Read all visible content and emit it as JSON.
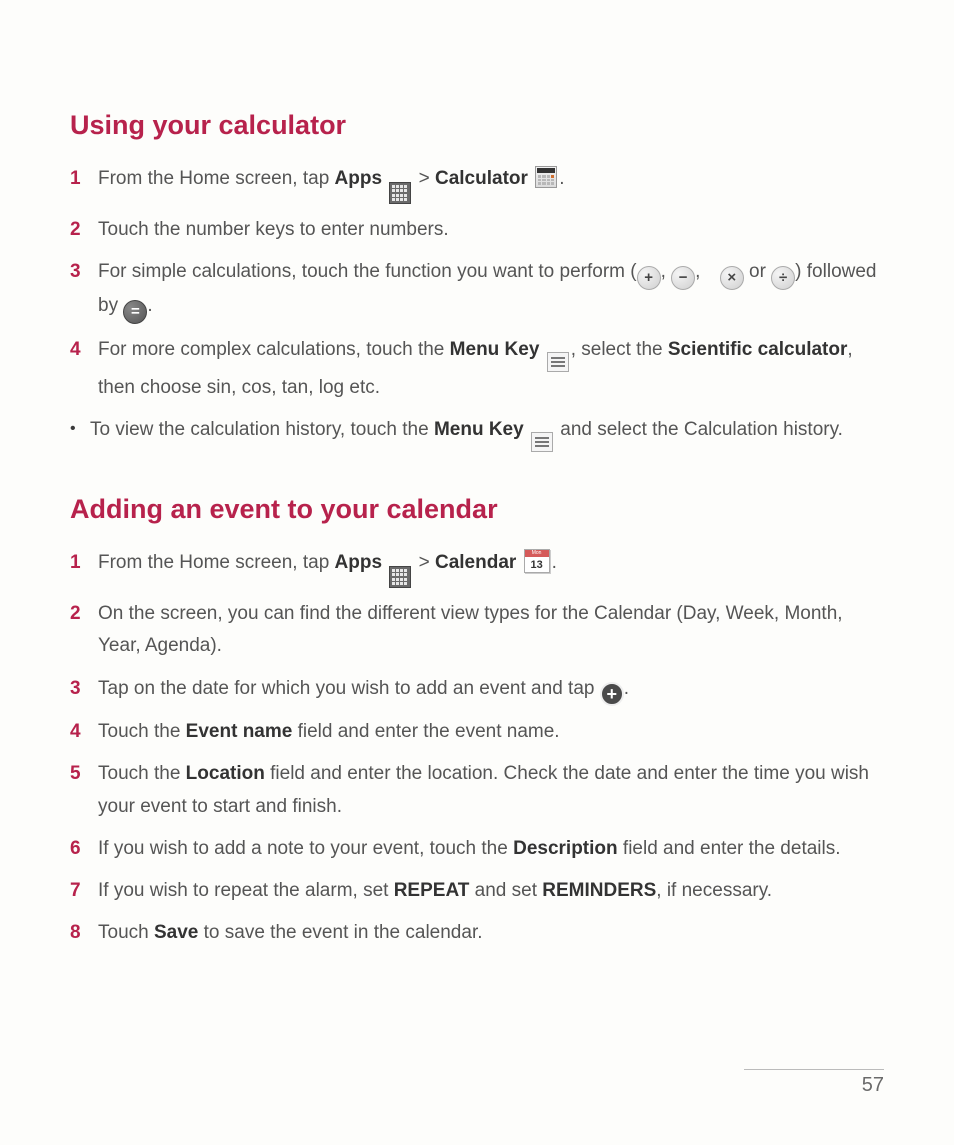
{
  "pageNumber": "57",
  "sections": [
    {
      "title": "Using your calculator",
      "steps": [
        {
          "num": "1",
          "type": "num",
          "pre": "From the Home screen, tap ",
          "bold1": "Apps",
          "mid1": " ",
          "icon1": "apps",
          " gt": " > ",
          "bold2": "Calculator",
          "icon2": "calc",
          "post": "."
        },
        {
          "num": "2",
          "type": "num",
          "text": "Touch the number keys to enter numbers."
        },
        {
          "num": "3",
          "type": "num",
          "preA": "For simple calculations, touch the function you want to perform (",
          "iconPlus": "plus",
          "c1": ", ",
          "iconMinus": "minus",
          "c2": ", ",
          "iconTimes": "times",
          "or": " or ",
          "iconDiv": "divide",
          "mid": ") followed by ",
          "iconEq": "equals",
          "post": "."
        },
        {
          "num": "4",
          "type": "num",
          "pre": "For more complex calculations, touch the ",
          "bold1": "Menu Key",
          "iconMenu": "menu",
          "mid": ", select the ",
          "bold2": "Scientific calculator",
          "post": ", then choose sin, cos, tan, log etc."
        },
        {
          "num": "•",
          "type": "bullet",
          "pre": "To view the calculation history, touch the ",
          "bold1": "Menu Key",
          "iconMenu": "menu",
          "mid": " and select the Calculation history."
        }
      ]
    },
    {
      "title": "Adding an event to your calendar",
      "steps": [
        {
          "num": "1",
          "type": "num",
          "pre": "From the Home screen, tap ",
          "bold1": "Apps",
          "icon1": "apps",
          "gt": " > ",
          "bold2": "Calendar",
          "icon2": "calendar",
          "calMon": "Mon",
          "calDay": "13",
          "post": "."
        },
        {
          "num": "2",
          "type": "num",
          "text": "On the screen, you can find the different view types for the Calendar (Day, Week, Month, Year, Agenda)."
        },
        {
          "num": "3",
          "type": "num",
          "pre": "Tap on the date for which you wish to add an event and tap ",
          "iconAdd": "add-event",
          "post": "."
        },
        {
          "num": "4",
          "type": "num",
          "pre": "Touch the ",
          "bold1": "Event name",
          "post": " field and enter the event name."
        },
        {
          "num": "5",
          "type": "num",
          "pre": "Touch the ",
          "bold1": "Location",
          "post": " field and enter the location. Check the date and enter the time you wish your event to start and finish."
        },
        {
          "num": "6",
          "type": "num",
          "pre": "If you wish to add a note to your event, touch the ",
          "bold1": "Description",
          "post": " field and enter the details."
        },
        {
          "num": "7",
          "type": "num",
          "pre": "If you wish to repeat the alarm, set ",
          "bold1": "REPEAT",
          "mid": " and set ",
          "bold2": "REMINDERS",
          "post": ", if necessary."
        },
        {
          "num": "8",
          "type": "num",
          "pre": "Touch ",
          "bold1": "Save",
          "post": " to save the event in the calendar."
        }
      ]
    }
  ]
}
